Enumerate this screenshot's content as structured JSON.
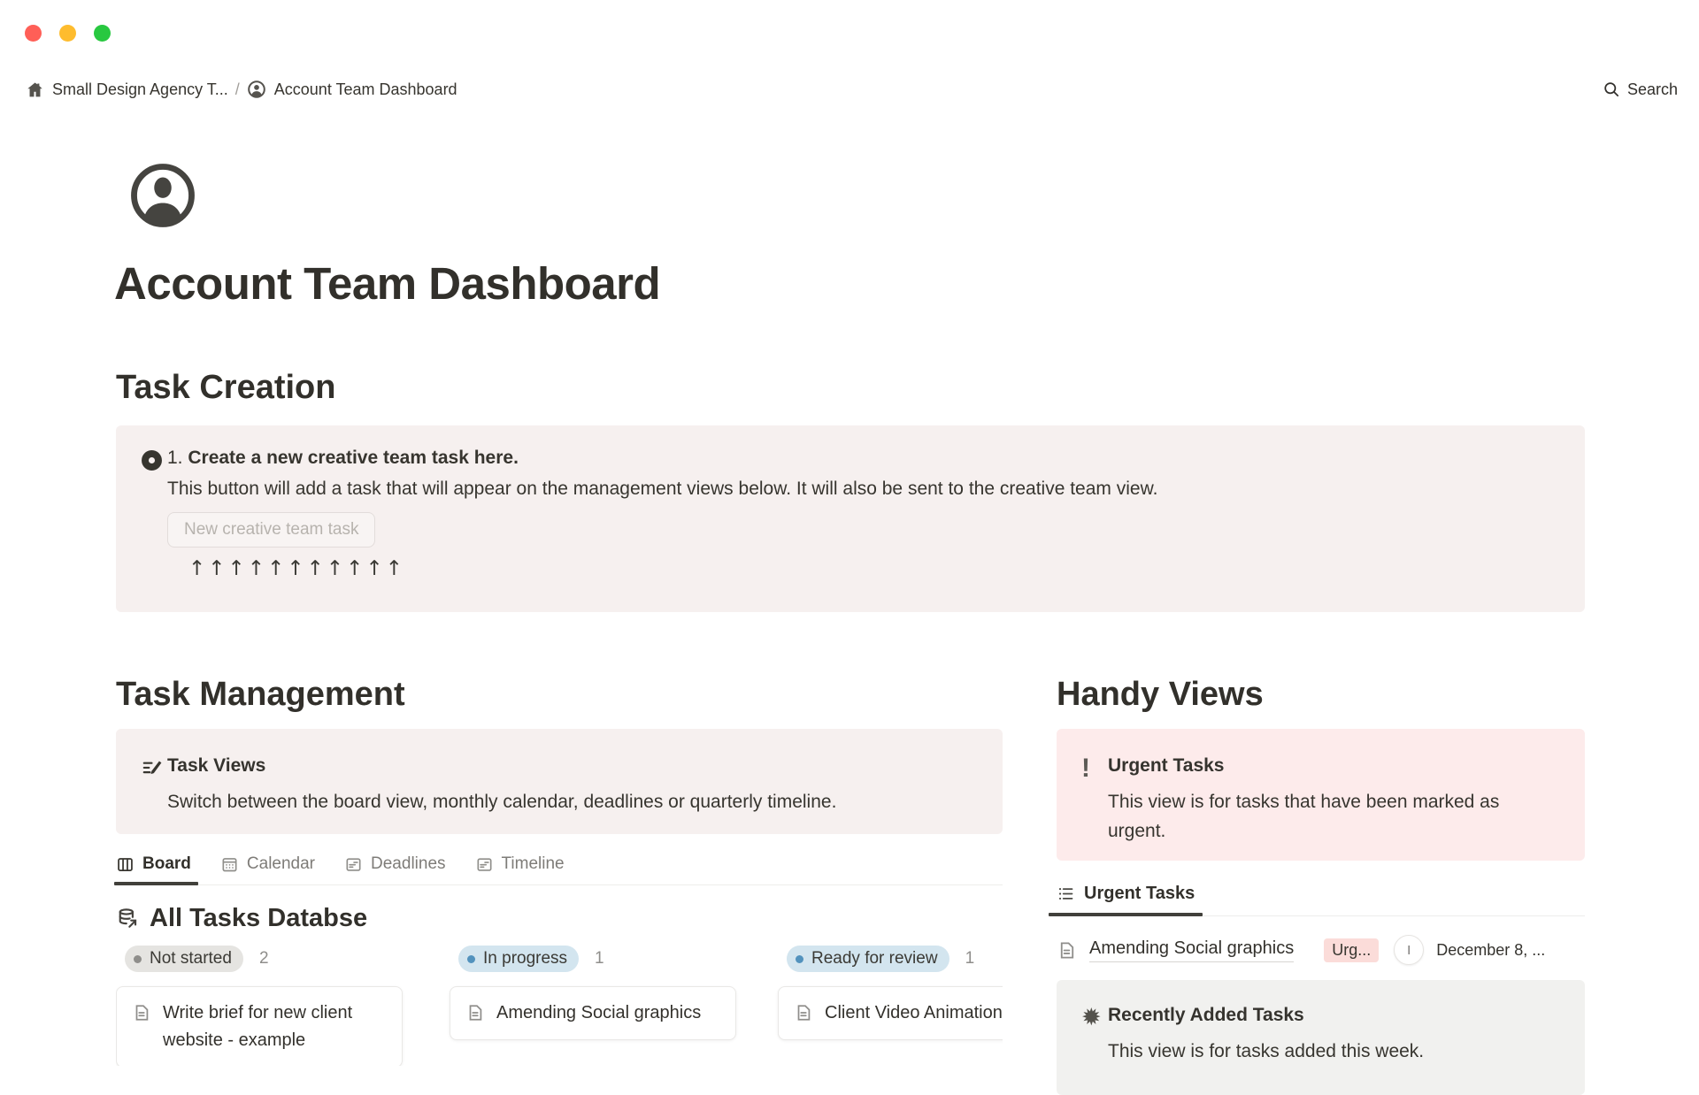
{
  "window": {
    "breadcrumb": {
      "workspace": "Small Design Agency T...",
      "separator": "/",
      "page": "Account Team Dashboard"
    },
    "search_label": "Search"
  },
  "page": {
    "title": "Account Team Dashboard"
  },
  "task_creation": {
    "heading": "Task Creation",
    "callout": {
      "number_prefix": "1. ",
      "title_bold": "Create a new creative team task here.",
      "body": "This button will add a task that will appear on the management views below. It will also be sent to the creative team view.",
      "button_label": "New creative team task",
      "arrows": "↑↑↑↑↑↑↑↑↑↑↑"
    }
  },
  "task_management": {
    "heading": "Task Management",
    "callout": {
      "title": "Task Views",
      "body": "Switch between the board view, monthly calendar, deadlines or quarterly timeline."
    },
    "tabs": [
      {
        "label": "Board"
      },
      {
        "label": "Calendar"
      },
      {
        "label": "Deadlines"
      },
      {
        "label": "Timeline"
      }
    ],
    "database_title": "All Tasks Databse",
    "board": {
      "columns": [
        {
          "status": "Not started",
          "count": "2",
          "color": "gray",
          "cards": [
            {
              "title": "Write brief for new client website - example"
            }
          ]
        },
        {
          "status": "In progress",
          "count": "1",
          "color": "blue",
          "cards": [
            {
              "title": "Amending Social graphics"
            }
          ]
        },
        {
          "status": "Ready for review",
          "count": "1",
          "color": "blue",
          "cards": [
            {
              "title": "Client Video Animation"
            }
          ]
        }
      ]
    }
  },
  "handy_views": {
    "heading": "Handy Views",
    "urgent_callout": {
      "icon_glyph": "!",
      "title": "Urgent Tasks",
      "body": "This view is for tasks that have been marked as urgent."
    },
    "view_tab": "Urgent Tasks",
    "list_row": {
      "title": "Amending Social graphics",
      "tag": "Urg...",
      "avatar_initial": "I",
      "date": "December 8, ..."
    },
    "recent_callout": {
      "icon_glyph": "✹",
      "title": "Recently Added Tasks",
      "body": "This view is for tasks added this week."
    }
  },
  "colors": {
    "text": "#37352f",
    "callout_warm_bg": "#f6f0ef",
    "urgent_bg": "#fdebeb",
    "neutral_callout_bg": "#f1f1ef",
    "status_gray_bg": "#e5e4e1",
    "status_blue_bg": "#d3e5ef",
    "status_blue_dot": "#5292bd",
    "tag_pink_bg": "#fbdcd9",
    "traffic_red": "#ff5f57",
    "traffic_yellow": "#febc2e",
    "traffic_green": "#28c840"
  }
}
